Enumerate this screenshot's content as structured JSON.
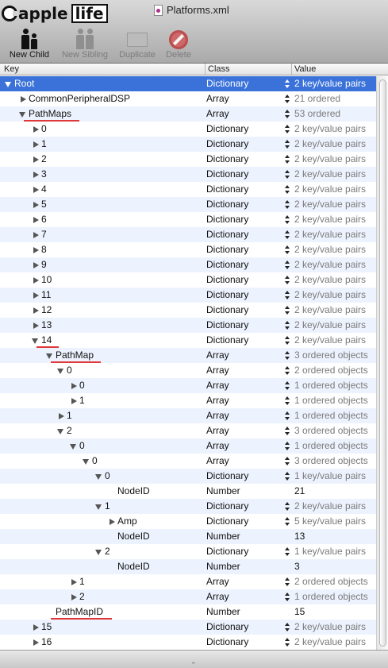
{
  "window": {
    "title": "Platforms.xml"
  },
  "logo": {
    "word1": "apple",
    "word2": "life"
  },
  "toolbar": {
    "new_child": "New Child",
    "new_sibling": "New Sibling",
    "duplicate": "Duplicate",
    "delete": "Delete"
  },
  "columns": {
    "key": "Key",
    "class": "Class",
    "value": "Value"
  },
  "rows": [
    {
      "key": "Root",
      "level": 0,
      "disc": "open",
      "cls": "Dictionary",
      "val": "2 key/value pairs",
      "step": true,
      "sel": true
    },
    {
      "key": "CommonPeripheralDSP",
      "level": 1,
      "disc": "closed",
      "cls": "Array",
      "val": "21 ordered",
      "step": true
    },
    {
      "key": "PathMaps",
      "level": 1,
      "disc": "open",
      "cls": "Array",
      "val": "53 ordered",
      "step": true,
      "ul": true
    },
    {
      "key": "0",
      "level": 2,
      "disc": "closed",
      "cls": "Dictionary",
      "val": "2 key/value pairs",
      "step": true
    },
    {
      "key": "1",
      "level": 2,
      "disc": "closed",
      "cls": "Dictionary",
      "val": "2 key/value pairs",
      "step": true
    },
    {
      "key": "2",
      "level": 2,
      "disc": "closed",
      "cls": "Dictionary",
      "val": "2 key/value pairs",
      "step": true
    },
    {
      "key": "3",
      "level": 2,
      "disc": "closed",
      "cls": "Dictionary",
      "val": "2 key/value pairs",
      "step": true
    },
    {
      "key": "4",
      "level": 2,
      "disc": "closed",
      "cls": "Dictionary",
      "val": "2 key/value pairs",
      "step": true
    },
    {
      "key": "5",
      "level": 2,
      "disc": "closed",
      "cls": "Dictionary",
      "val": "2 key/value pairs",
      "step": true
    },
    {
      "key": "6",
      "level": 2,
      "disc": "closed",
      "cls": "Dictionary",
      "val": "2 key/value pairs",
      "step": true
    },
    {
      "key": "7",
      "level": 2,
      "disc": "closed",
      "cls": "Dictionary",
      "val": "2 key/value pairs",
      "step": true
    },
    {
      "key": "8",
      "level": 2,
      "disc": "closed",
      "cls": "Dictionary",
      "val": "2 key/value pairs",
      "step": true
    },
    {
      "key": "9",
      "level": 2,
      "disc": "closed",
      "cls": "Dictionary",
      "val": "2 key/value pairs",
      "step": true
    },
    {
      "key": "10",
      "level": 2,
      "disc": "closed",
      "cls": "Dictionary",
      "val": "2 key/value pairs",
      "step": true
    },
    {
      "key": "11",
      "level": 2,
      "disc": "closed",
      "cls": "Dictionary",
      "val": "2 key/value pairs",
      "step": true
    },
    {
      "key": "12",
      "level": 2,
      "disc": "closed",
      "cls": "Dictionary",
      "val": "2 key/value pairs",
      "step": true
    },
    {
      "key": "13",
      "level": 2,
      "disc": "closed",
      "cls": "Dictionary",
      "val": "2 key/value pairs",
      "step": true
    },
    {
      "key": "14",
      "level": 2,
      "disc": "open",
      "cls": "Dictionary",
      "val": "2 key/value pairs",
      "step": true,
      "ul": true
    },
    {
      "key": "PathMap",
      "level": 3,
      "disc": "open",
      "cls": "Array",
      "val": "3 ordered objects",
      "step": true,
      "ul": true
    },
    {
      "key": "0",
      "level": 4,
      "disc": "open",
      "cls": "Array",
      "val": "2 ordered objects",
      "step": true
    },
    {
      "key": "0",
      "level": 5,
      "disc": "closed",
      "cls": "Array",
      "val": "1 ordered objects",
      "step": true
    },
    {
      "key": "1",
      "level": 5,
      "disc": "closed",
      "cls": "Array",
      "val": "1 ordered objects",
      "step": true
    },
    {
      "key": "1",
      "level": 4,
      "disc": "closed",
      "cls": "Array",
      "val": "1 ordered objects",
      "step": true
    },
    {
      "key": "2",
      "level": 4,
      "disc": "open",
      "cls": "Array",
      "val": "3 ordered objects",
      "step": true
    },
    {
      "key": "0",
      "level": 5,
      "disc": "open",
      "cls": "Array",
      "val": "1 ordered objects",
      "step": true
    },
    {
      "key": "0",
      "level": 6,
      "disc": "open",
      "cls": "Array",
      "val": "3 ordered objects",
      "step": true
    },
    {
      "key": "0",
      "level": 7,
      "disc": "open",
      "cls": "Dictionary",
      "val": "1 key/value pairs",
      "step": true
    },
    {
      "key": "NodeID",
      "level": 8,
      "disc": "none",
      "cls": "Number",
      "val": "21",
      "step": false,
      "plain": true
    },
    {
      "key": "1",
      "level": 7,
      "disc": "open",
      "cls": "Dictionary",
      "val": "2 key/value pairs",
      "step": true
    },
    {
      "key": "Amp",
      "level": 8,
      "disc": "closed",
      "cls": "Dictionary",
      "val": "5 key/value pairs",
      "step": true
    },
    {
      "key": "NodeID",
      "level": 8,
      "disc": "none",
      "cls": "Number",
      "val": "13",
      "step": false,
      "plain": true
    },
    {
      "key": "2",
      "level": 7,
      "disc": "open",
      "cls": "Dictionary",
      "val": "1 key/value pairs",
      "step": true
    },
    {
      "key": "NodeID",
      "level": 8,
      "disc": "none",
      "cls": "Number",
      "val": "3",
      "step": false,
      "plain": true
    },
    {
      "key": "1",
      "level": 5,
      "disc": "closed",
      "cls": "Array",
      "val": "2 ordered objects",
      "step": true
    },
    {
      "key": "2",
      "level": 5,
      "disc": "closed",
      "cls": "Array",
      "val": "1 ordered objects",
      "step": true
    },
    {
      "key": "PathMapID",
      "level": 3,
      "disc": "none",
      "cls": "Number",
      "val": "15",
      "step": false,
      "plain": true,
      "ul": true
    },
    {
      "key": "15",
      "level": 2,
      "disc": "closed",
      "cls": "Dictionary",
      "val": "2 key/value pairs",
      "step": true
    },
    {
      "key": "16",
      "level": 2,
      "disc": "closed",
      "cls": "Dictionary",
      "val": "2 key/value pairs",
      "step": true
    }
  ],
  "colors": {
    "selection": "#3a72d9",
    "annotation": "#e0383a",
    "alt_row": "#edf3fe"
  }
}
